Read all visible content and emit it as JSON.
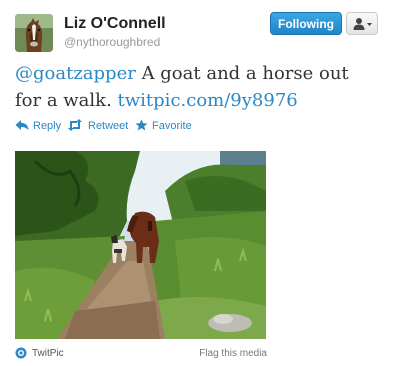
{
  "author": {
    "name": "Liz O'Connell",
    "handle": "@nythoroughbred"
  },
  "follow_button": {
    "label": "Following"
  },
  "tweet": {
    "mention": "@goatzapper",
    "text": " A goat and a horse out for a walk. ",
    "link": "twitpic.com/9y8976"
  },
  "actions": {
    "reply": "Reply",
    "retweet": "Retweet",
    "favorite": "Favorite"
  },
  "media": {
    "provider": "TwitPic",
    "flag": "Flag this media"
  },
  "colors": {
    "link": "#2a88c6",
    "follow_button": "#2a94d6",
    "text": "#333333",
    "muted": "#999999"
  },
  "icons": {
    "reply": "reply-arrow-icon",
    "retweet": "retweet-arrows-icon",
    "favorite": "star-icon",
    "user_menu": "user-silhouette-icon",
    "provider": "twitpic-logo-icon"
  }
}
